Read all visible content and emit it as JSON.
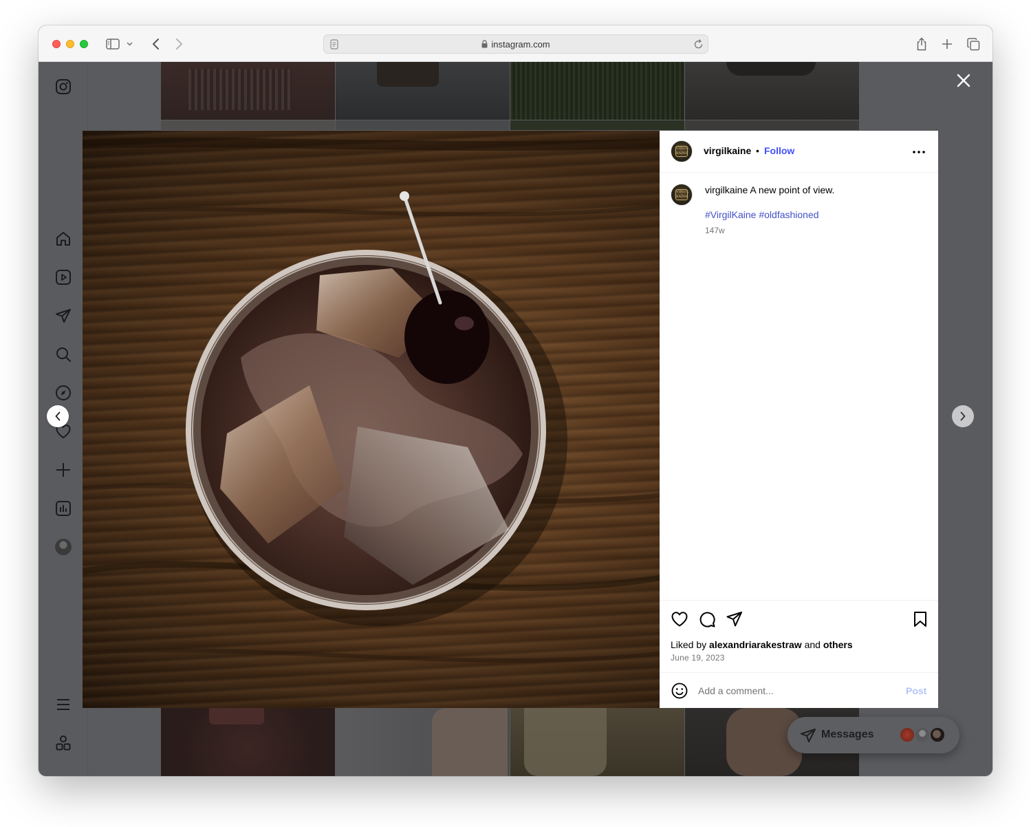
{
  "browser": {
    "url": "instagram.com"
  },
  "post": {
    "username": "virgilkaine",
    "separator": "•",
    "follow_label": "Follow",
    "avatar_text": "VIRGIL KAINE",
    "caption_user": "virgilkaine",
    "caption_text": " A new point of view.",
    "hashtags": "#VirgilKaine #oldfashioned",
    "age": "147w",
    "liked_prefix": "Liked by ",
    "liked_user": "alexandriarakestraw",
    "liked_middle": " and ",
    "liked_others": "others",
    "date": "June 19, 2023",
    "comment_placeholder": "Add a comment...",
    "post_label": "Post"
  },
  "messages": {
    "label": "Messages"
  },
  "colors": {
    "accent_link": "#4150f7",
    "hashtag": "#4150c8",
    "post_button_disabled": "#b3c5f9",
    "overlay": "#595b60"
  },
  "icons": {
    "nav": [
      "instagram-logo-icon",
      "home-icon",
      "reels-icon",
      "direct-icon",
      "search-icon",
      "explore-icon",
      "heart-icon",
      "create-icon",
      "insights-icon",
      "profile-avatar",
      "menu-icon",
      "apps-icon"
    ],
    "actions": [
      "like-icon",
      "comment-icon",
      "share-icon",
      "save-icon"
    ]
  }
}
